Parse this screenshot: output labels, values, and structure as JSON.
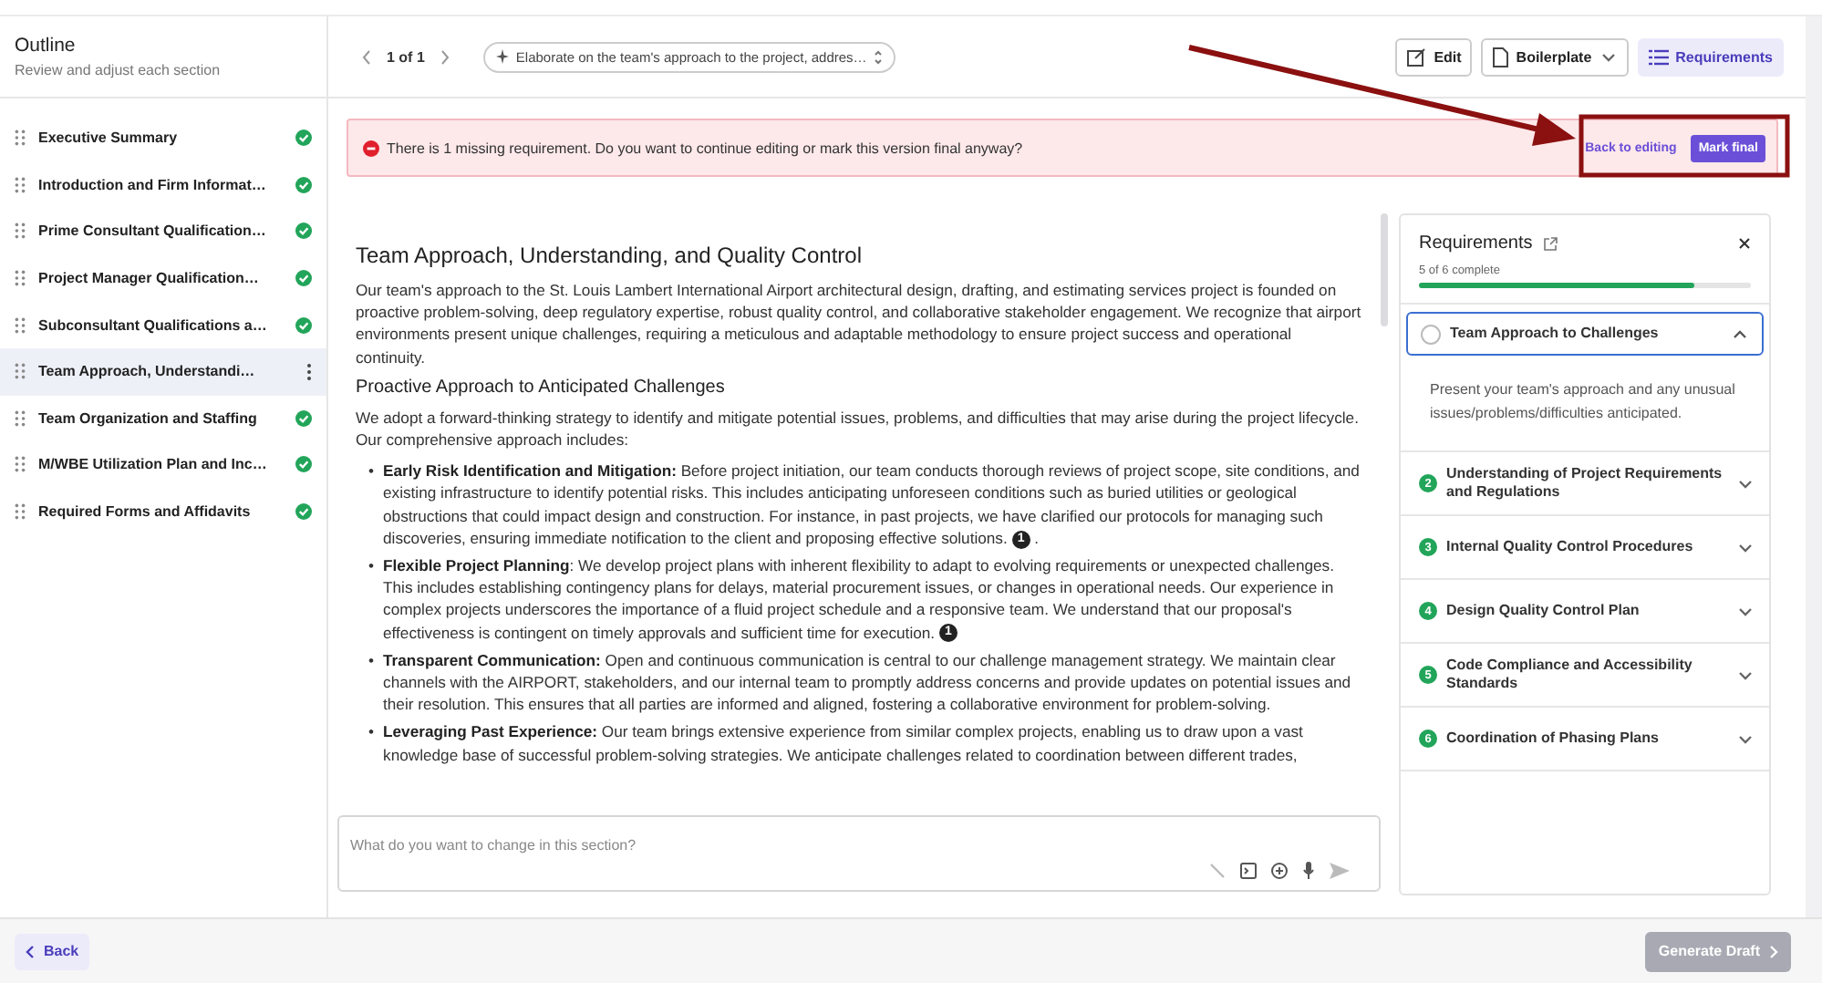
{
  "sidebar": {
    "title": "Outline",
    "subtitle": "Review and adjust each section",
    "items": [
      {
        "label": "Executive Summary",
        "done": true,
        "selected": false
      },
      {
        "label": "Introduction and Firm Informat…",
        "done": true,
        "selected": false
      },
      {
        "label": "Prime Consultant Qualification…",
        "done": true,
        "selected": false
      },
      {
        "label": "Project Manager Qualification…",
        "done": true,
        "selected": false
      },
      {
        "label": "Subconsultant Qualifications a…",
        "done": true,
        "selected": false
      },
      {
        "label": "Team Approach, Understandi…",
        "done": false,
        "selected": true
      },
      {
        "label": "Team Organization and Staffing",
        "done": true,
        "selected": false
      },
      {
        "label": "M/WBE Utilization Plan and Inc…",
        "done": true,
        "selected": false
      },
      {
        "label": "Required Forms and Affidavits",
        "done": true,
        "selected": false
      }
    ]
  },
  "toolbar": {
    "pager": "1 of 1",
    "prompt_select": "Elaborate on the team's approach to the project, addres…",
    "actions": [
      {
        "label": "Edit",
        "kind": "edit",
        "selected": false
      },
      {
        "label": "Boilerplate",
        "kind": "dropdown",
        "selected": false
      },
      {
        "label": "Requirements",
        "kind": "list",
        "selected": true
      }
    ]
  },
  "alert": {
    "message": "There is 1 missing requirement. Do you want to continue editing or mark this version final anyway?",
    "secondary": "Back to editing",
    "primary": "Mark final"
  },
  "annotation": {
    "shown": true
  },
  "document": {
    "title": "Team Approach, Understanding, and Quality Control",
    "intro": "Our team's approach to the St. Louis Lambert International Airport architectural design, drafting, and estimating services project is founded on proactive problem-solving, deep regulatory expertise, robust quality control, and collaborative stakeholder engagement. We recognize that airport environments present unique challenges, requiring a meticulous and adaptable methodology to ensure project success and operational continuity.",
    "subheading": "Proactive Approach to Anticipated Challenges",
    "lead": "We adopt a forward-thinking strategy to identify and mitigate potential issues, problems, and difficulties that may arise during the project lifecycle. Our comprehensive approach includes:",
    "marker": "•",
    "bullets": [
      {
        "text": "**Early Risk Identification and Mitigation:** Before project initiation, our team conducts thorough reviews of project scope, site conditions, and existing infrastructure to identify potential risks. This includes anticipating unforeseen conditions such as buried utilities or geological obstructions that could impact design and construction. For instance, in past projects, we have clarified our protocols for managing such discoveries, ensuring immediate notification to the client and proposing effective solutions.",
        "citation": "1",
        "after": "."
      },
      {
        "text": "**Flexible Project Planning**: We develop project plans with inherent flexibility to adapt to evolving requirements or unexpected challenges. This includes establishing contingency plans for delays, material procurement issues, or changes in operational needs. Our experience in complex projects underscores the importance of a fluid project schedule and a responsive team. We understand that our proposal's effectiveness is contingent on timely approvals and sufficient time for execution.",
        "citation": "1"
      },
      {
        "text": "**Transparent Communication:** Open and continuous communication is central to our challenge management strategy. We maintain clear channels with the AIRPORT, stakeholders, and our internal team to promptly address concerns and provide updates on potential issues and their resolution. This ensures that all parties are informed and aligned, fostering a collaborative environment for problem-solving."
      },
      {
        "text": "**Leveraging Past Experience:** Our team brings extensive experience from similar complex projects, enabling us to draw upon a vast knowledge base of successful problem-solving strategies. We anticipate challenges related to coordination between different trades,"
      }
    ]
  },
  "prompt": {
    "placeholder": "What do you want to change in this section?"
  },
  "requirements": {
    "title": "Requirements",
    "progress_text": "5 of 6 complete",
    "level": 0.83,
    "items": [
      {
        "title": "Team Approach to Challenges",
        "done": false,
        "expanded": true,
        "description": "Present your team's approach and any unusual issues/problems/difficulties anticipated."
      },
      {
        "number": "2",
        "title": "Understanding of Project Requirements and Regulations",
        "done": true,
        "expanded": false
      },
      {
        "number": "3",
        "title": "Internal Quality Control Procedures",
        "done": true,
        "expanded": false
      },
      {
        "number": "4",
        "title": "Design Quality Control Plan",
        "done": true,
        "expanded": false
      },
      {
        "number": "5",
        "title": "Code Compliance and Accessibility Standards",
        "done": true,
        "expanded": false
      },
      {
        "number": "6",
        "title": "Coordination of Phasing Plans",
        "done": true,
        "expanded": false
      }
    ]
  },
  "footer": {
    "back": "Back",
    "generate": "Generate Draft",
    "generate_disabled": true
  }
}
